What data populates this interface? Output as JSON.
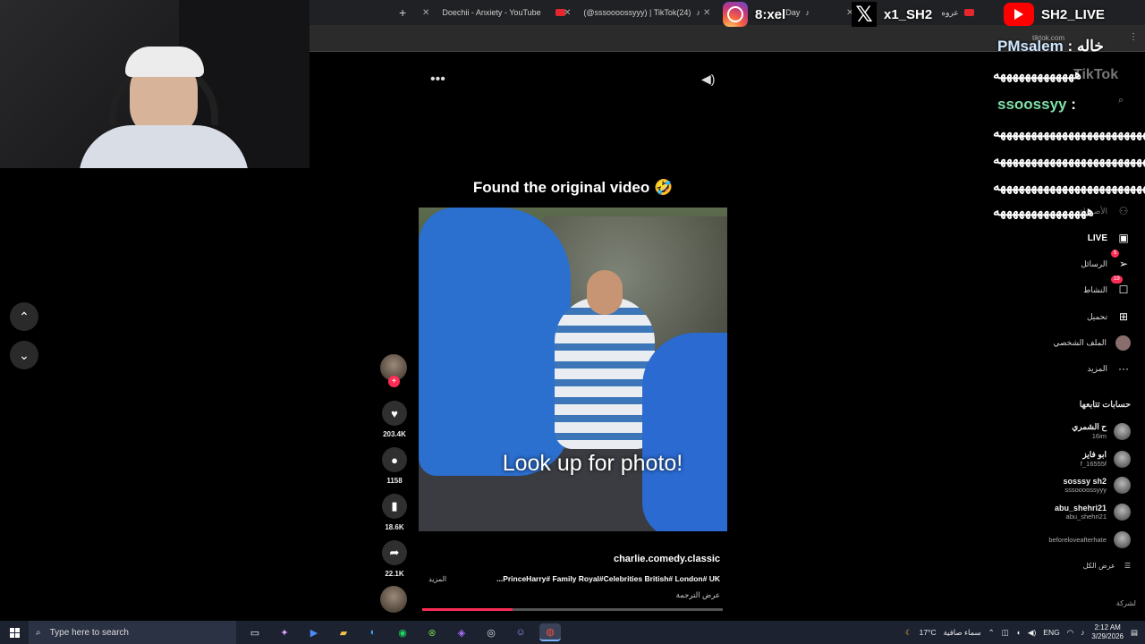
{
  "browser": {
    "tabs": [
      {
        "title": "Doechii - Anxiety - YouTube",
        "icon": "youtube-icon"
      },
      {
        "title": "(@sssoooossyyy) | TikTok(24)",
        "icon": "tiktok-icon"
      },
      {
        "title": "Day",
        "icon": "tiktok-icon"
      },
      {
        "title": "عروه",
        "icon": "youtube-icon"
      }
    ],
    "url_fragment": "tiktok.com"
  },
  "social_overlay": {
    "instagram": "8:xel",
    "x": "x1_SH2",
    "youtube": "SH2_LIVE"
  },
  "chat": {
    "messages": [
      {
        "user": "PMsalem",
        "sep": ":",
        "text": "خاله"
      },
      {
        "user": "ssoossyy",
        "sep": ":",
        "text": ""
      }
    ],
    "laugh_lines": [
      "هههههههههههههه",
      "هههههههههههههههههههههههههه",
      "هههههههههههههههههههههههههه",
      "هههههههههههههههههههههههههه",
      "هههههههههههههههه"
    ]
  },
  "video": {
    "title": "Found the original video 🤣",
    "caption": "Look up for photo!",
    "author": "charlie.comedy.classic",
    "hashtags": "...PrinceHarry# Family Royal#Celebrities British# London# UK",
    "more": "المزيد",
    "translate": "عرض الترجمة",
    "progress": 0.3
  },
  "actions": {
    "likes": "203.4K",
    "comments": "1158",
    "saves": "18.6K",
    "shares": "22.1K"
  },
  "sidebar": {
    "brand": "TikTok",
    "friends": "الأصدقاء",
    "live": "LIVE",
    "messages": "الرسائل",
    "messages_badge": "5",
    "activity": "النشاط",
    "activity_badge": "19",
    "upload": "تحميل",
    "profile": "الملف الشخصي",
    "more": "المزيد",
    "following_title": "حسابات تتابعها",
    "accounts": [
      {
        "name": "ح الشمري",
        "handle": "16im"
      },
      {
        "name": "ابو فايز",
        "handle": "f_16555f"
      },
      {
        "name": "sosssy sh2",
        "handle": "sssoooossyyy"
      },
      {
        "name": "abu_shehri21",
        "handle": "abu_shehri21"
      },
      {
        "name": "",
        "handle": "beforeloveafterhate"
      }
    ],
    "see_all": "عرض الكل",
    "company": "لشركة"
  },
  "taskbar": {
    "search_placeholder": "Type here to search",
    "temperature": "17°C",
    "weather": "سماء صافية",
    "language": "ENG",
    "time": "2:12 AM",
    "date": "3/29/2026"
  }
}
